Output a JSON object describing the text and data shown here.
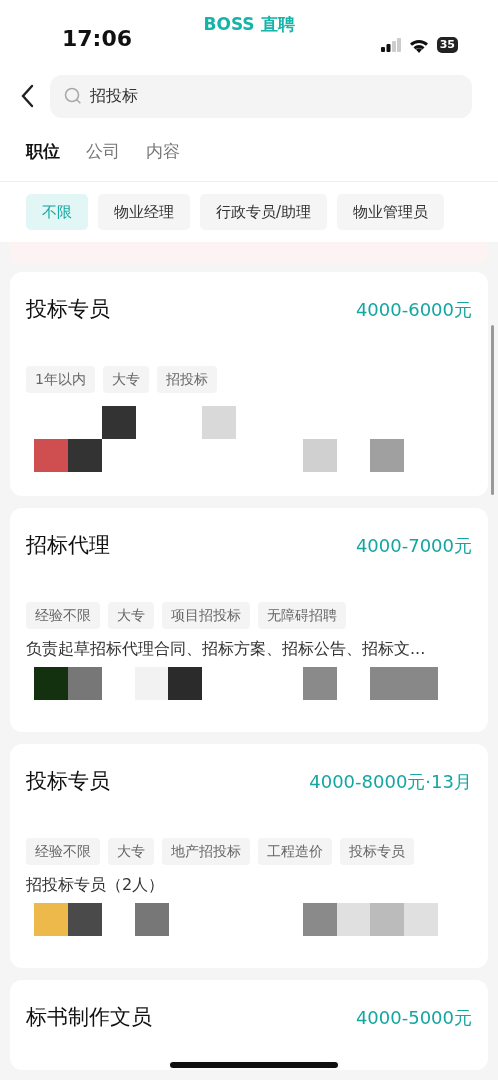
{
  "status_bar": {
    "time": "17:06",
    "app_name": "BOSS 直聘",
    "battery": "35"
  },
  "search": {
    "value": "招投标"
  },
  "tabs": [
    {
      "label": "职位",
      "selected": true
    },
    {
      "label": "公司",
      "selected": false
    },
    {
      "label": "内容",
      "selected": false
    }
  ],
  "filters": [
    {
      "label": "不限",
      "selected": true
    },
    {
      "label": "物业经理",
      "selected": false
    },
    {
      "label": "行政专员/助理",
      "selected": false
    },
    {
      "label": "物业管理员",
      "selected": false
    }
  ],
  "jobs": [
    {
      "title": "投标专员",
      "salary": "4000-6000元",
      "tags": [
        "1年以内",
        "大专",
        "招投标"
      ],
      "mosaic": {
        "kind": "picture"
      }
    },
    {
      "title": "招标代理",
      "salary": "4000-7000元",
      "tags": [
        "经验不限",
        "大专",
        "项目招投标",
        "无障碍招聘"
      ],
      "description": "负责起草招标代理合同、招标方案、招标公告、招标文...",
      "mosaic": {
        "kind": "picture"
      }
    },
    {
      "title": "投标专员",
      "salary": "4000-8000元·13月",
      "tags": [
        "经验不限",
        "大专",
        "地产招投标",
        "工程造价",
        "投标专员"
      ],
      "description": "招投标专员（2人）",
      "mosaic": {
        "kind": "picture"
      }
    },
    {
      "title": "标书制作文员",
      "salary": "4000-5000元"
    }
  ]
}
